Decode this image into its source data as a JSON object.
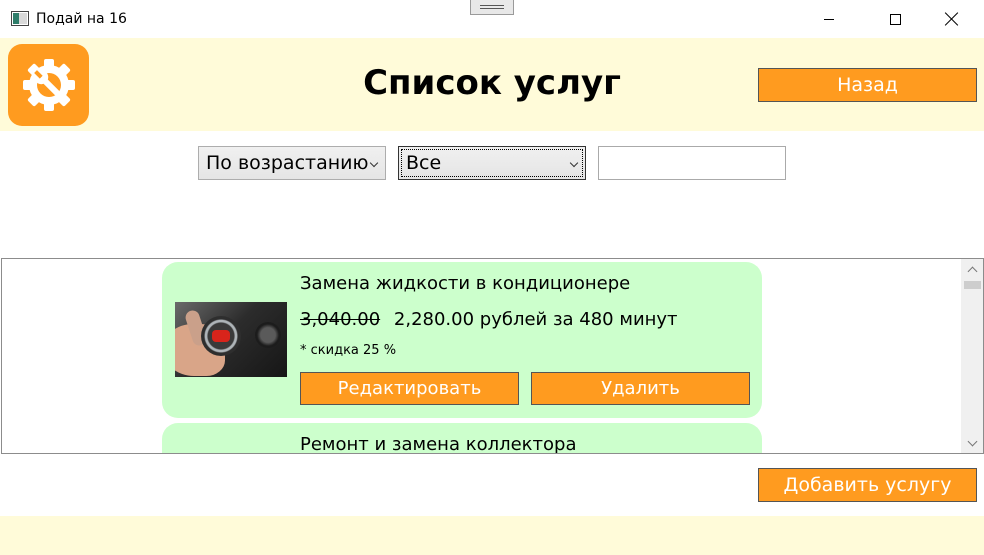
{
  "window": {
    "title": "Подай на 16"
  },
  "header": {
    "title": "Список услуг",
    "back_label": "Назад"
  },
  "filters": {
    "sort_selected": "По возрастанию",
    "discount_selected": "Все",
    "search_value": ""
  },
  "services": [
    {
      "title": "Замена жидкости в кондиционере",
      "old_price": "3,040.00",
      "new_price": "2,280.00",
      "price_suffix": "рублей за 480 минут",
      "discount_note": "* скидка 25 %",
      "image": "car-climate-control-photo"
    },
    {
      "title": "Ремонт и замена коллектора"
    }
  ],
  "card_actions": {
    "edit_label": "Редактировать",
    "delete_label": "Удалить"
  },
  "footer": {
    "add_label": "Добавить услугу"
  },
  "colors": {
    "header_bg": "#fffbd9",
    "accent": "#ff9b1f",
    "card_bg": "#ccffcc"
  }
}
